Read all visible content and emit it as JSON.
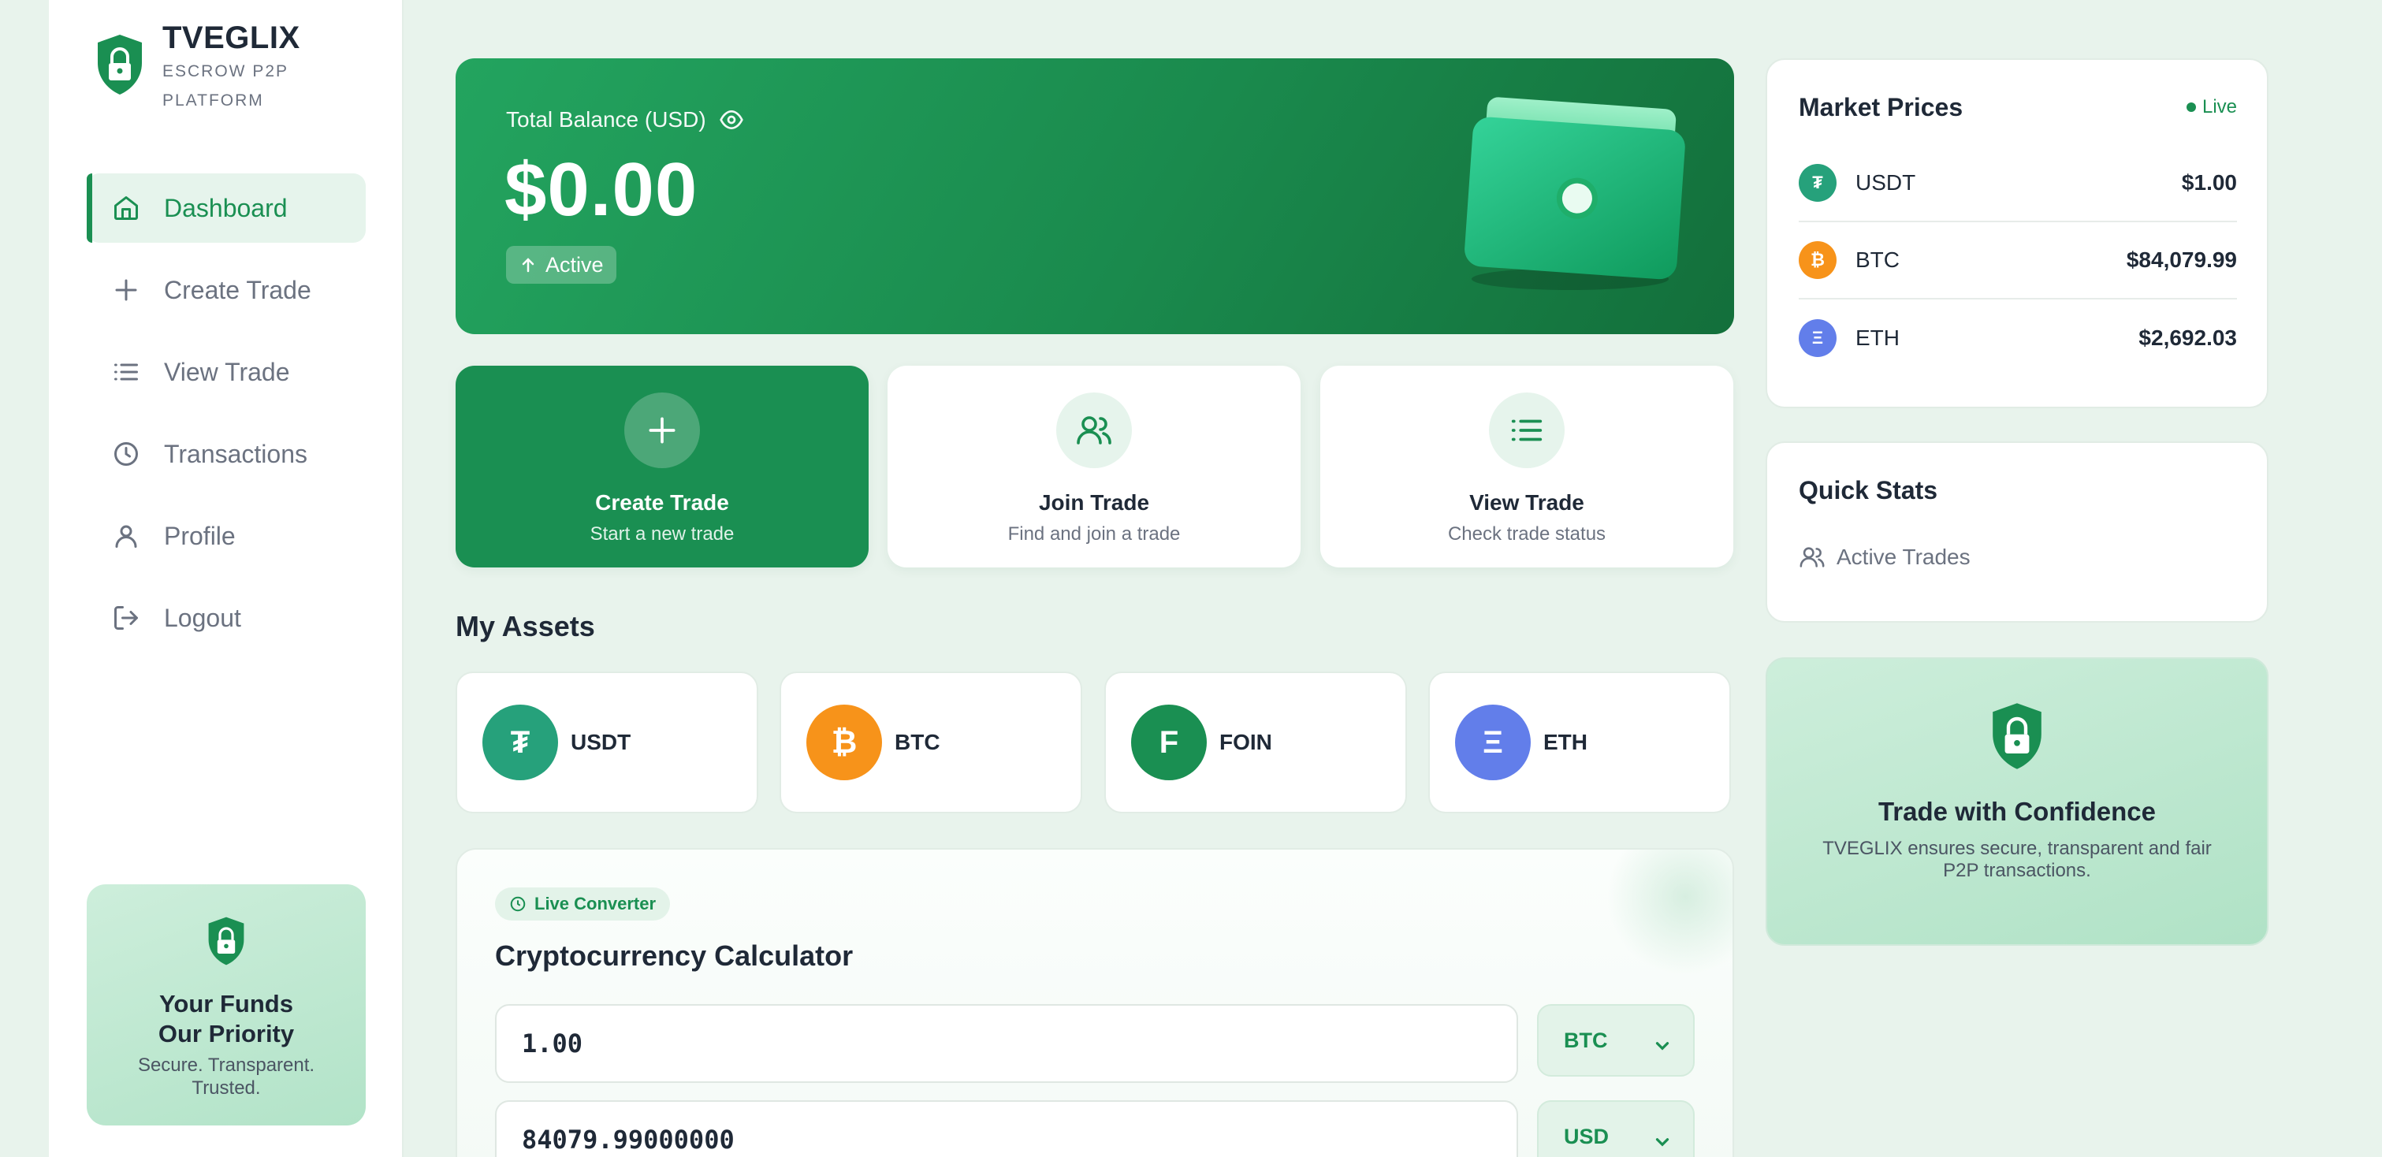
{
  "brand": {
    "title": "TVEGLIX",
    "subtitle": "ESCROW P2P PLATFORM"
  },
  "nav": [
    {
      "label": "Dashboard",
      "icon": "home-icon",
      "active": true
    },
    {
      "label": "Create Trade",
      "icon": "plus-icon"
    },
    {
      "label": "View Trade",
      "icon": "list-icon"
    },
    {
      "label": "Transactions",
      "icon": "clock-icon"
    },
    {
      "label": "Profile",
      "icon": "user-icon"
    },
    {
      "label": "Logout",
      "icon": "logout-icon"
    }
  ],
  "sidebar_promo": {
    "title_line1": "Your Funds",
    "title_line2": "Our Priority",
    "text": "Secure. Transparent. Trusted."
  },
  "balance": {
    "label": "Total Balance (USD)",
    "amount": "$0.00",
    "status": "Active"
  },
  "actions": [
    {
      "title": "Create Trade",
      "subtitle": "Start a new trade"
    },
    {
      "title": "Join Trade",
      "subtitle": "Find and join a trade"
    },
    {
      "title": "View Trade",
      "subtitle": "Check trade status"
    }
  ],
  "assets": {
    "title": "My Assets",
    "items": [
      {
        "symbol": "₮",
        "name": "USDT",
        "color": "#26a17b"
      },
      {
        "symbol": "₿",
        "name": "BTC",
        "color": "#f7931a"
      },
      {
        "symbol": "F",
        "name": "FOIN",
        "color": "#1a8f52"
      },
      {
        "symbol": "Ξ",
        "name": "ETH",
        "color": "#627eea"
      }
    ]
  },
  "calculator": {
    "badge": "Live Converter",
    "title": "Cryptocurrency Calculator",
    "amount": "1.00",
    "from_currency": "BTC",
    "result": "84079.99000000",
    "to_currency": "USD"
  },
  "market": {
    "title": "Market Prices",
    "live": "Live",
    "rows": [
      {
        "symbol": "₮",
        "name": "USDT",
        "price": "$1.00",
        "color": "#26a17b"
      },
      {
        "symbol": "₿",
        "name": "BTC",
        "price": "$84,079.99",
        "color": "#f7931a"
      },
      {
        "symbol": "Ξ",
        "name": "ETH",
        "price": "$2,692.03",
        "color": "#627eea"
      }
    ]
  },
  "quick_stats": {
    "title": "Quick Stats",
    "active_trades": "Active Trades"
  },
  "confidence": {
    "title": "Trade with Confidence",
    "text": "TVEGLIX ensures secure, transparent and fair P2P transactions."
  }
}
